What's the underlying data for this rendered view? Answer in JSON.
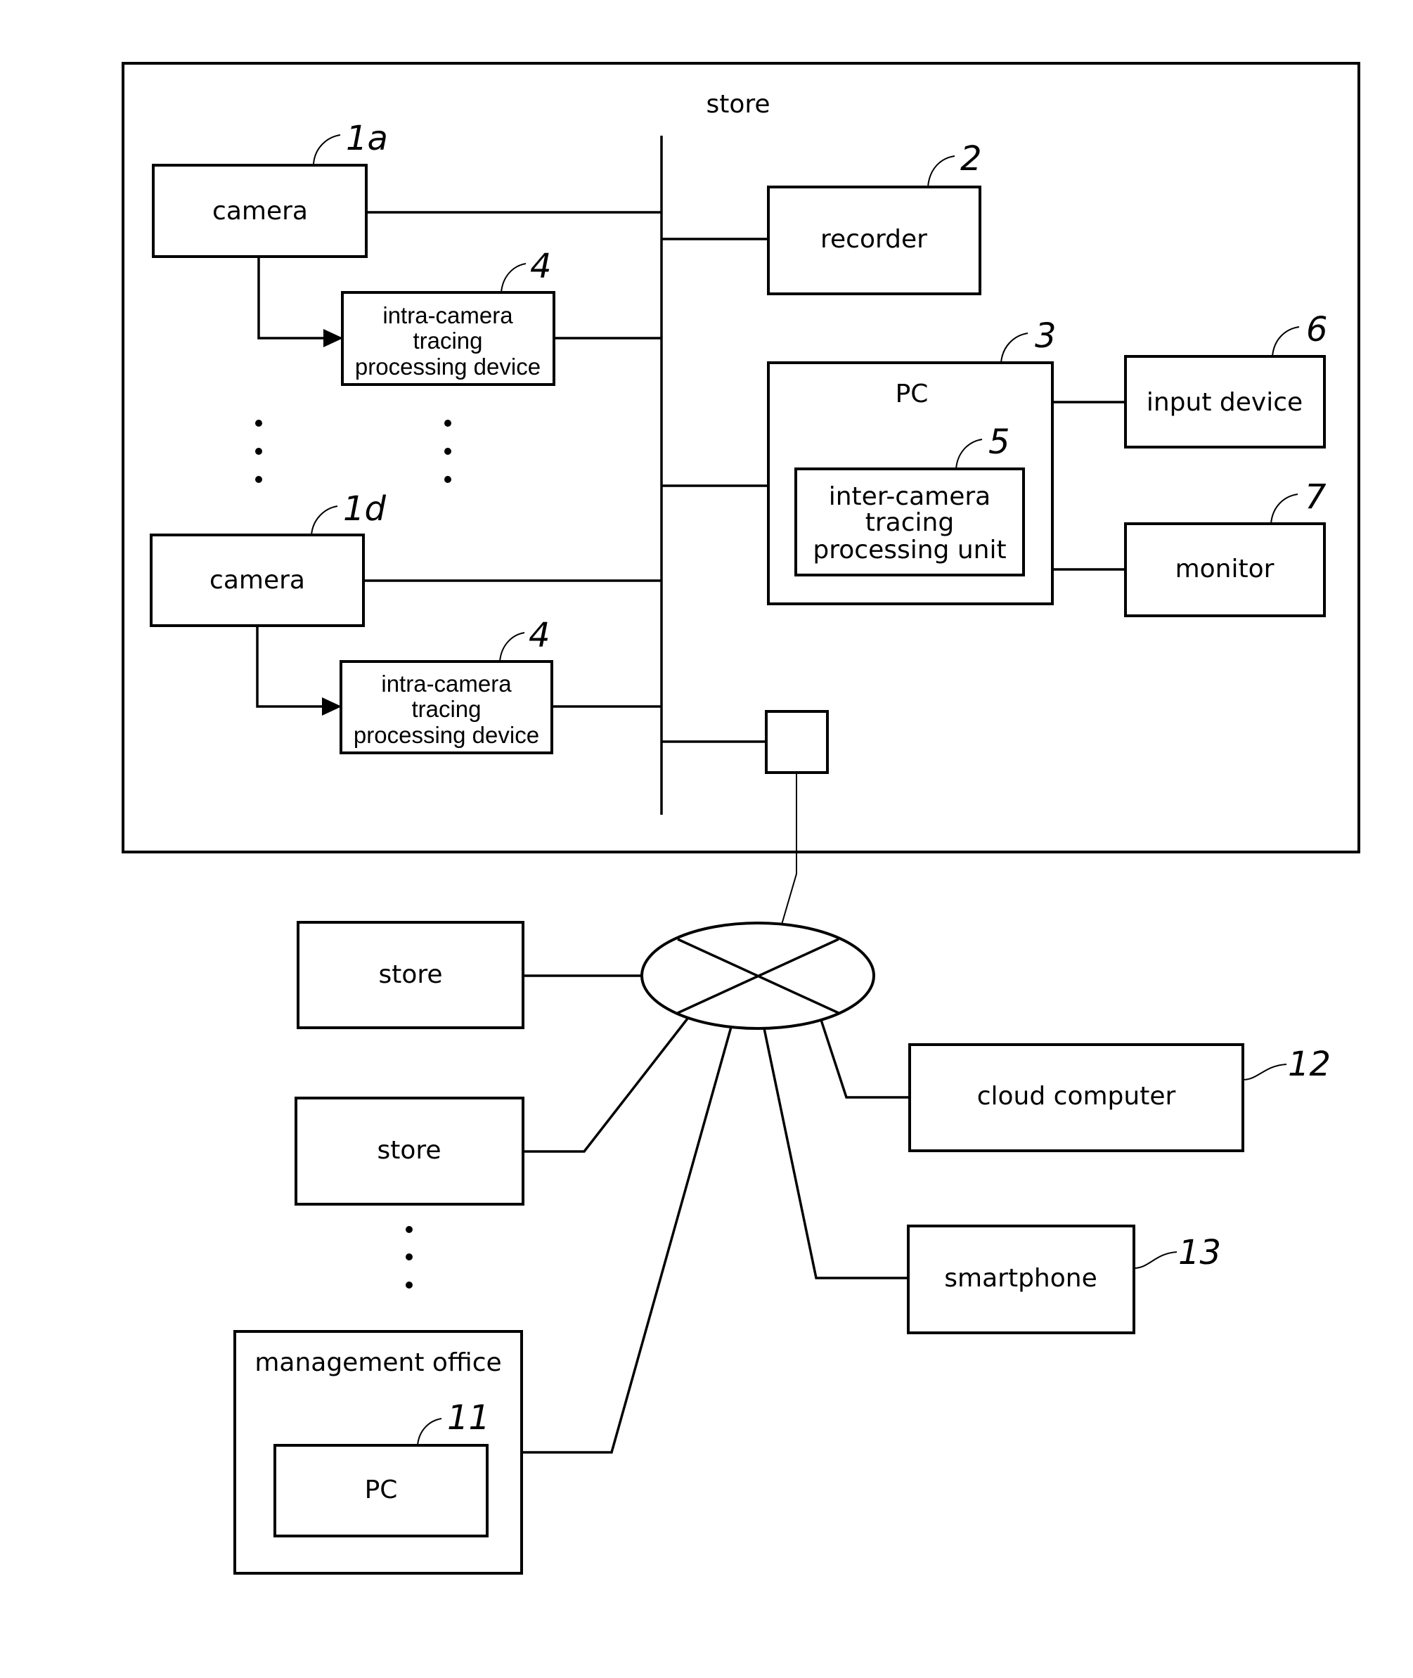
{
  "diagram": {
    "store_main": {
      "label": "store"
    },
    "camera_1a": {
      "label": "camera",
      "ref": "1a"
    },
    "camera_1d": {
      "label": "camera",
      "ref": "1d"
    },
    "intra_device_1": {
      "lines": [
        "intra-camera",
        "tracing",
        "processing device"
      ],
      "ref": "4"
    },
    "intra_device_2": {
      "lines": [
        "intra-camera",
        "tracing",
        "processing device"
      ],
      "ref": "4"
    },
    "recorder": {
      "label": "recorder",
      "ref": "2"
    },
    "pc_store": {
      "label": "PC",
      "ref": "3"
    },
    "inter_unit": {
      "lines": [
        "inter-camera",
        "tracing",
        "processing unit"
      ],
      "ref": "5"
    },
    "input_device": {
      "label": "input device",
      "ref": "6"
    },
    "monitor": {
      "label": "monitor",
      "ref": "7"
    },
    "other_store_1": {
      "label": "store"
    },
    "other_store_2": {
      "label": "store"
    },
    "management_office": {
      "label": "management office"
    },
    "pc_office": {
      "label": "PC",
      "ref": "11"
    },
    "cloud_computer": {
      "label": "cloud computer",
      "ref": "12"
    },
    "smartphone": {
      "label": "smartphone",
      "ref": "13"
    }
  }
}
